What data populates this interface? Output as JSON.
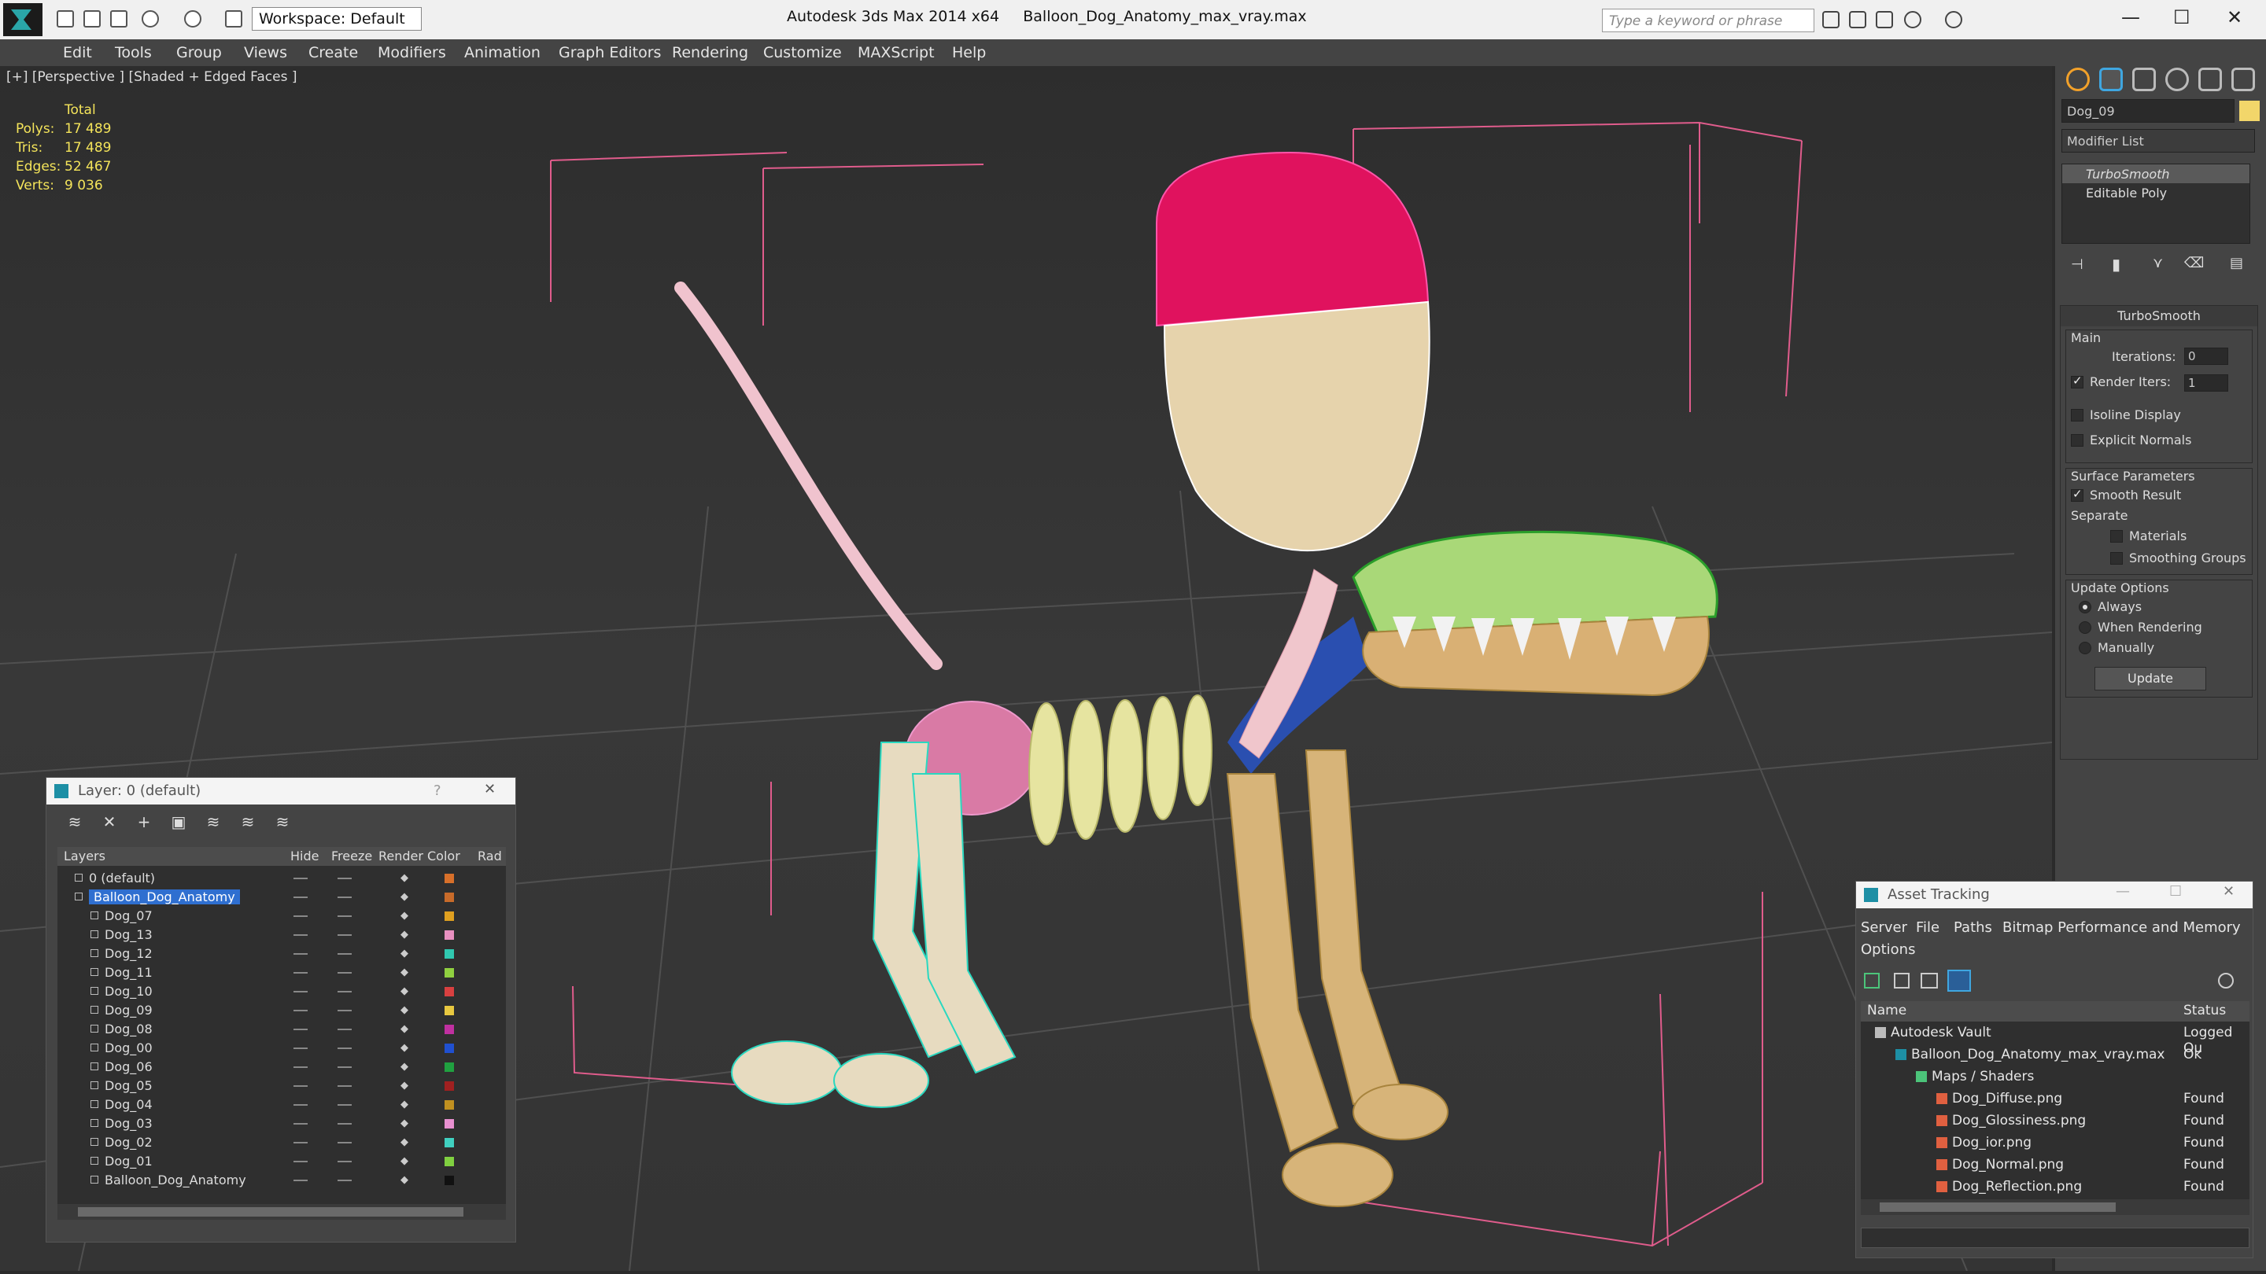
{
  "titlebar": {
    "workspace": "Workspace: Default",
    "app": "Autodesk 3ds Max  2014 x64",
    "file": "Balloon_Dog_Anatomy_max_vray.max",
    "search_placeholder": "Type a keyword or phrase"
  },
  "menu": [
    "Edit",
    "Tools",
    "Group",
    "Views",
    "Create",
    "Modifiers",
    "Animation",
    "Graph Editors",
    "Rendering",
    "Customize",
    "MAXScript",
    "Help"
  ],
  "viewport": {
    "label": "[+] [Perspective ] [Shaded + Edged Faces ]",
    "stats_header": "Total",
    "stats": [
      {
        "k": "Polys:",
        "v": "17 489"
      },
      {
        "k": "Tris:",
        "v": "17 489"
      },
      {
        "k": "Edges:",
        "v": "52 467"
      },
      {
        "k": "Verts:",
        "v": "9 036"
      }
    ]
  },
  "rpanel": {
    "object_name": "Dog_09",
    "modifier_list": "Modifier List",
    "stack": [
      "TurboSmooth",
      "Editable Poly"
    ],
    "rollout": "TurboSmooth",
    "main": "Main",
    "iterations_label": "Iterations:",
    "iterations": "0",
    "render_iters_label": "Render Iters:",
    "render_iters": "1",
    "isoline": "Isoline Display",
    "explicit": "Explicit Normals",
    "surface": "Surface Parameters",
    "smooth": "Smooth Result",
    "separate": "Separate",
    "materials": "Materials",
    "smoothing": "Smoothing Groups",
    "update_options": "Update Options",
    "always": "Always",
    "when_rendering": "When Rendering",
    "manually": "Manually",
    "update": "Update"
  },
  "layers": {
    "title": "Layer: 0 (default)",
    "help": "?",
    "cols": [
      "Layers",
      "Hide",
      "Freeze",
      "Render",
      "Color",
      "Rad"
    ],
    "rows": [
      {
        "name": "0 (default)",
        "color": "#d8702a",
        "indent": 0
      },
      {
        "name": "Balloon_Dog_Anatomy",
        "color": "#c86b2a",
        "indent": 0,
        "sel": true
      },
      {
        "name": "Dog_07",
        "color": "#e0a020",
        "indent": 1
      },
      {
        "name": "Dog_13",
        "color": "#e890c0",
        "indent": 1
      },
      {
        "name": "Dog_12",
        "color": "#30c8b0",
        "indent": 1
      },
      {
        "name": "Dog_11",
        "color": "#90d040",
        "indent": 1
      },
      {
        "name": "Dog_10",
        "color": "#d84040",
        "indent": 1
      },
      {
        "name": "Dog_09",
        "color": "#e8c840",
        "indent": 1
      },
      {
        "name": "Dog_08",
        "color": "#c030a0",
        "indent": 1
      },
      {
        "name": "Dog_00",
        "color": "#2050d0",
        "indent": 1
      },
      {
        "name": "Dog_06",
        "color": "#20a040",
        "indent": 1
      },
      {
        "name": "Dog_05",
        "color": "#a02020",
        "indent": 1
      },
      {
        "name": "Dog_04",
        "color": "#c09020",
        "indent": 1
      },
      {
        "name": "Dog_03",
        "color": "#e890d0",
        "indent": 1
      },
      {
        "name": "Dog_02",
        "color": "#40d0c0",
        "indent": 1
      },
      {
        "name": "Dog_01",
        "color": "#80d040",
        "indent": 1
      },
      {
        "name": "Balloon_Dog_Anatomy",
        "color": "#111111",
        "indent": 1
      }
    ]
  },
  "asset": {
    "title": "Asset Tracking",
    "menu": [
      "Server",
      "File",
      "Paths",
      "Bitmap Performance and Memory",
      "Options"
    ],
    "cols": [
      "Name",
      "Status"
    ],
    "rows": [
      {
        "name": "Autodesk Vault",
        "status": "Logged Ou",
        "indent": 0
      },
      {
        "name": "Balloon_Dog_Anatomy_max_vray.max",
        "status": "Ok",
        "indent": 1
      },
      {
        "name": "Maps / Shaders",
        "status": "",
        "indent": 2
      },
      {
        "name": "Dog_Diffuse.png",
        "status": "Found",
        "indent": 3
      },
      {
        "name": "Dog_Glossiness.png",
        "status": "Found",
        "indent": 3
      },
      {
        "name": "Dog_ior.png",
        "status": "Found",
        "indent": 3
      },
      {
        "name": "Dog_Normal.png",
        "status": "Found",
        "indent": 3
      },
      {
        "name": "Dog_Reflection.png",
        "status": "Found",
        "indent": 3
      }
    ]
  }
}
